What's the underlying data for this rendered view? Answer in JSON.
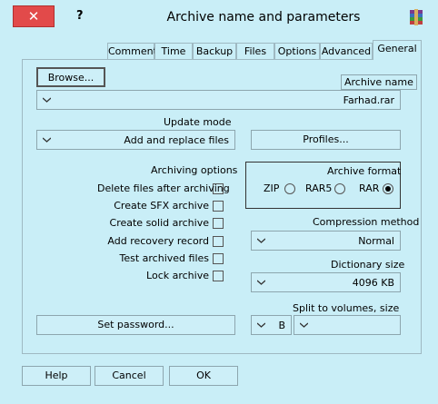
{
  "window": {
    "title": "Archive name and parameters",
    "help": "?",
    "close": "✕"
  },
  "tabs": [
    "General",
    "Advanced",
    "Options",
    "Files",
    "Backup",
    "Time",
    "Comment"
  ],
  "general": {
    "archive_name_label": "Archive name",
    "browse_button": "Browse...",
    "archive_name_value": "Farhad.rar",
    "update_mode_label": "Update mode",
    "update_mode_value": "Add and replace files",
    "profiles_button": "Profiles...",
    "archive_format": {
      "label": "Archive format",
      "options": [
        "RAR",
        "RAR5",
        "ZIP"
      ],
      "selected": "RAR"
    },
    "archiving_options": {
      "label": "Archiving options",
      "items": [
        {
          "label": "Delete files after archiving",
          "checked": false
        },
        {
          "label": "Create SFX archive",
          "checked": false
        },
        {
          "label": "Create solid archive",
          "checked": false
        },
        {
          "label": "Add recovery record",
          "checked": false
        },
        {
          "label": "Test archived files",
          "checked": false
        },
        {
          "label": "Lock archive",
          "checked": false
        }
      ]
    },
    "compression_method_label": "Compression method",
    "compression_method_value": "Normal",
    "dictionary_size_label": "Dictionary size",
    "dictionary_size_value": "4096 KB",
    "split_label": "Split to volumes, size",
    "split_unit_value": "B",
    "split_size_value": "",
    "set_password_button": "Set password..."
  },
  "footer": {
    "ok": "OK",
    "cancel": "Cancel",
    "help": "Help"
  }
}
